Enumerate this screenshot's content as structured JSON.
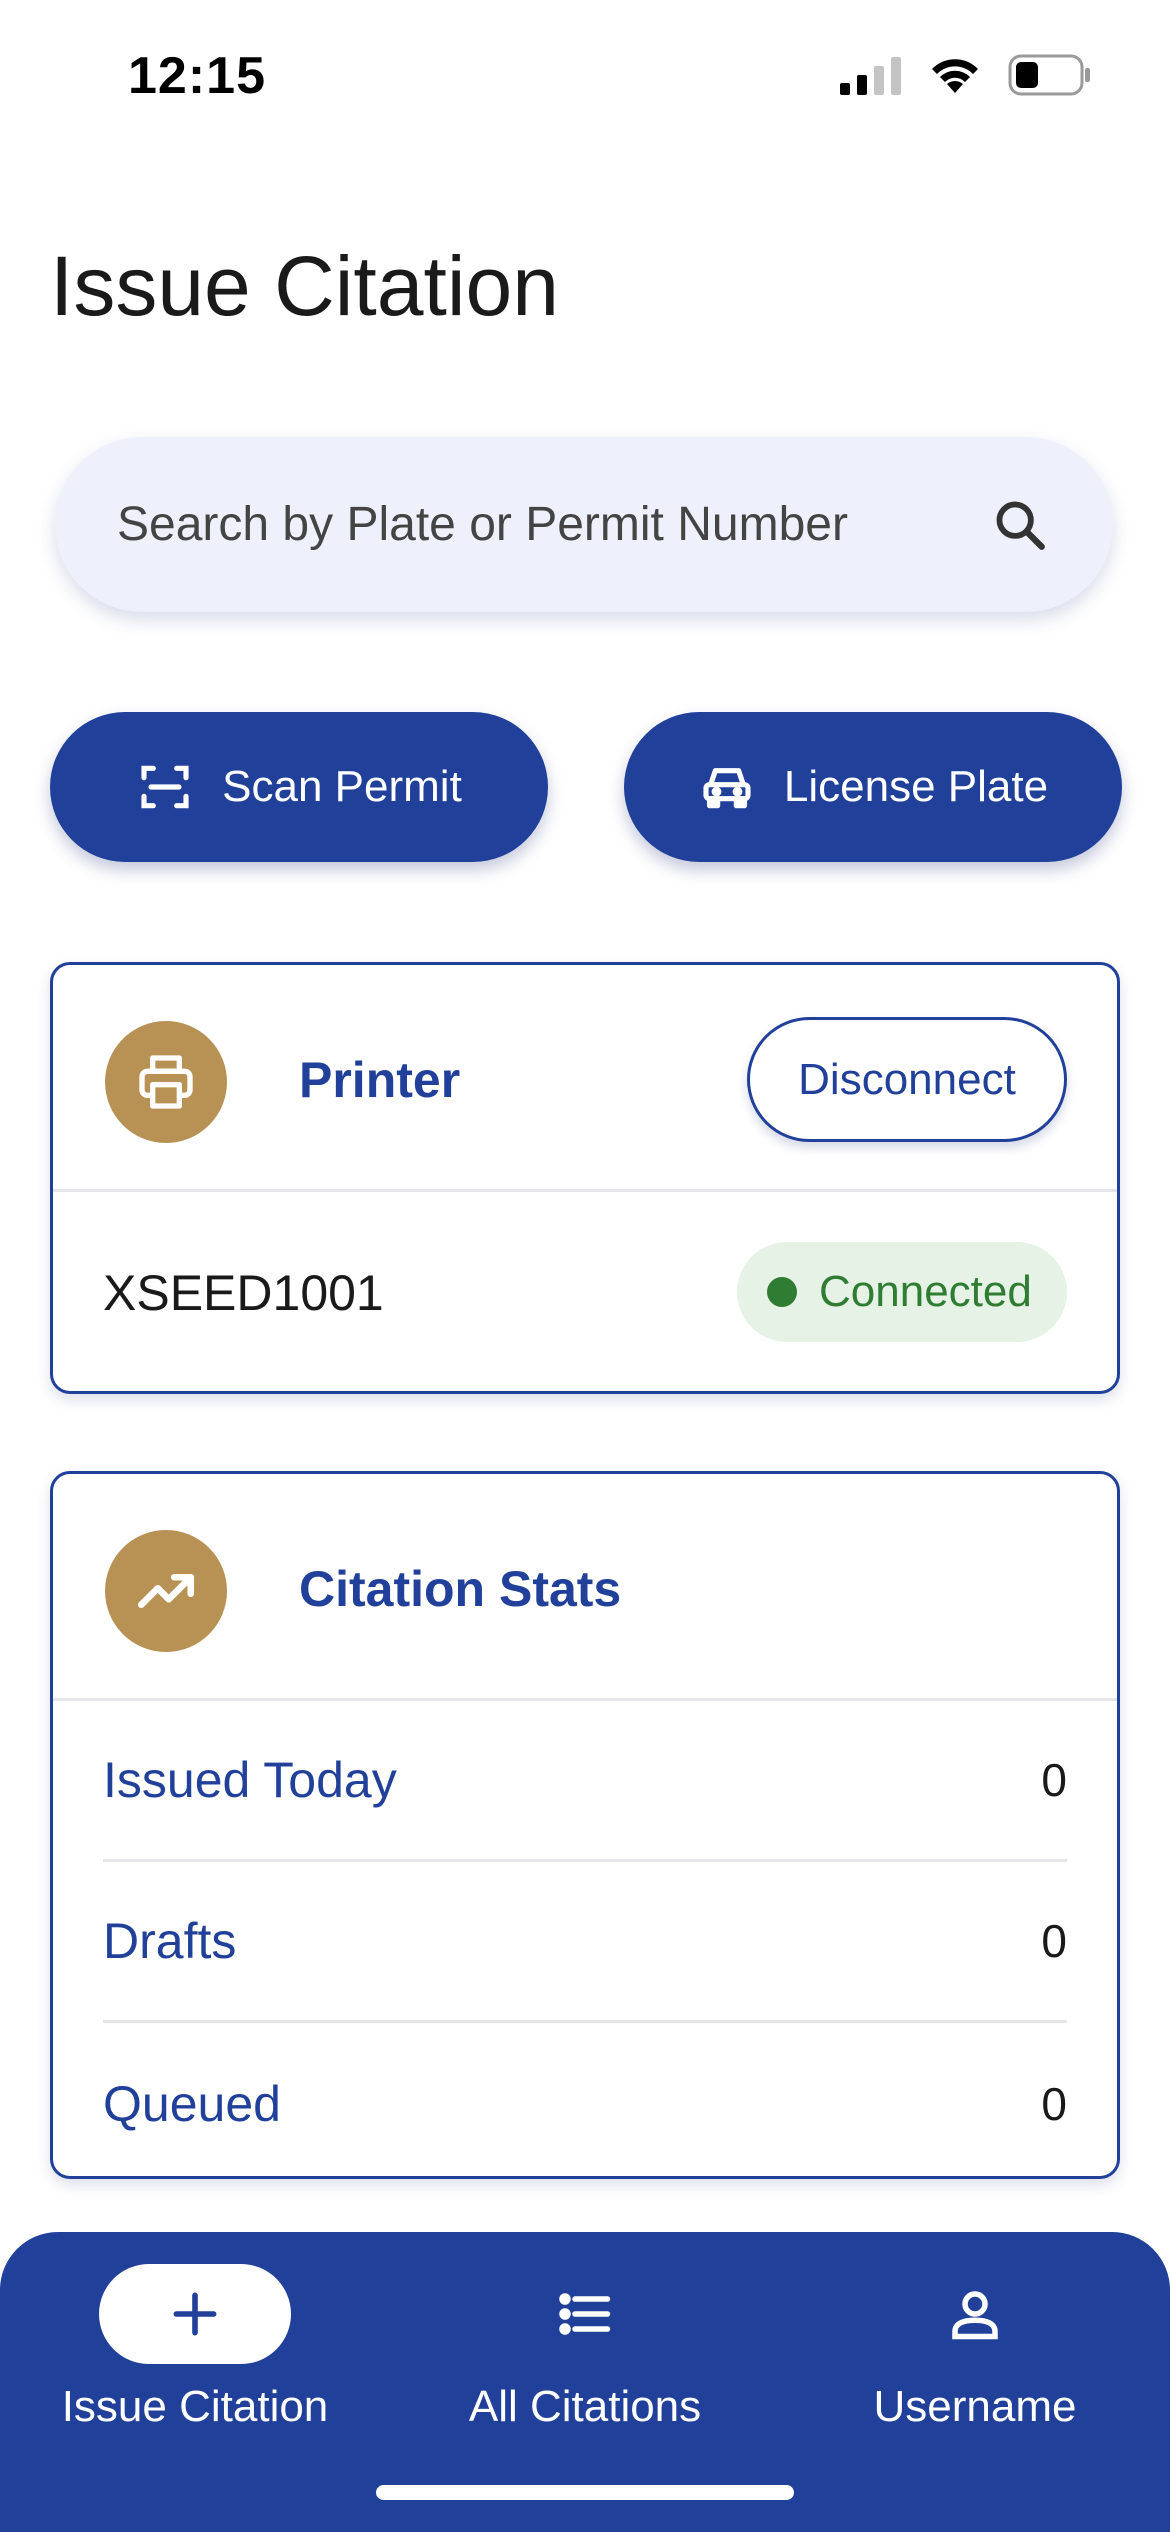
{
  "status_bar": {
    "time": "12:15"
  },
  "page": {
    "title": "Issue Citation"
  },
  "search": {
    "placeholder": "Search by Plate or Permit Number",
    "icon": "search-icon"
  },
  "actions": {
    "scan_permit": {
      "label": "Scan Permit",
      "icon": "scan-icon"
    },
    "license_plate": {
      "label": "License Plate",
      "icon": "car-icon"
    }
  },
  "printer": {
    "title": "Printer",
    "icon": "printer-icon",
    "disconnect_label": "Disconnect",
    "device_name": "XSEED1001",
    "status": "Connected",
    "status_color": "#2e7d32"
  },
  "stats": {
    "title": "Citation Stats",
    "icon": "trending-up-icon",
    "rows": [
      {
        "label": "Issued Today",
        "value": "0"
      },
      {
        "label": "Drafts",
        "value": "0"
      },
      {
        "label": "Queued",
        "value": "0"
      }
    ]
  },
  "nav": {
    "items": [
      {
        "label": "Issue Citation",
        "icon": "plus-icon",
        "active": true
      },
      {
        "label": "All Citations",
        "icon": "list-icon",
        "active": false
      },
      {
        "label": "Username",
        "icon": "user-icon",
        "active": false
      }
    ]
  },
  "colors": {
    "primary": "#21409a",
    "accent": "#b89255",
    "search_bg": "#eef1fb"
  }
}
